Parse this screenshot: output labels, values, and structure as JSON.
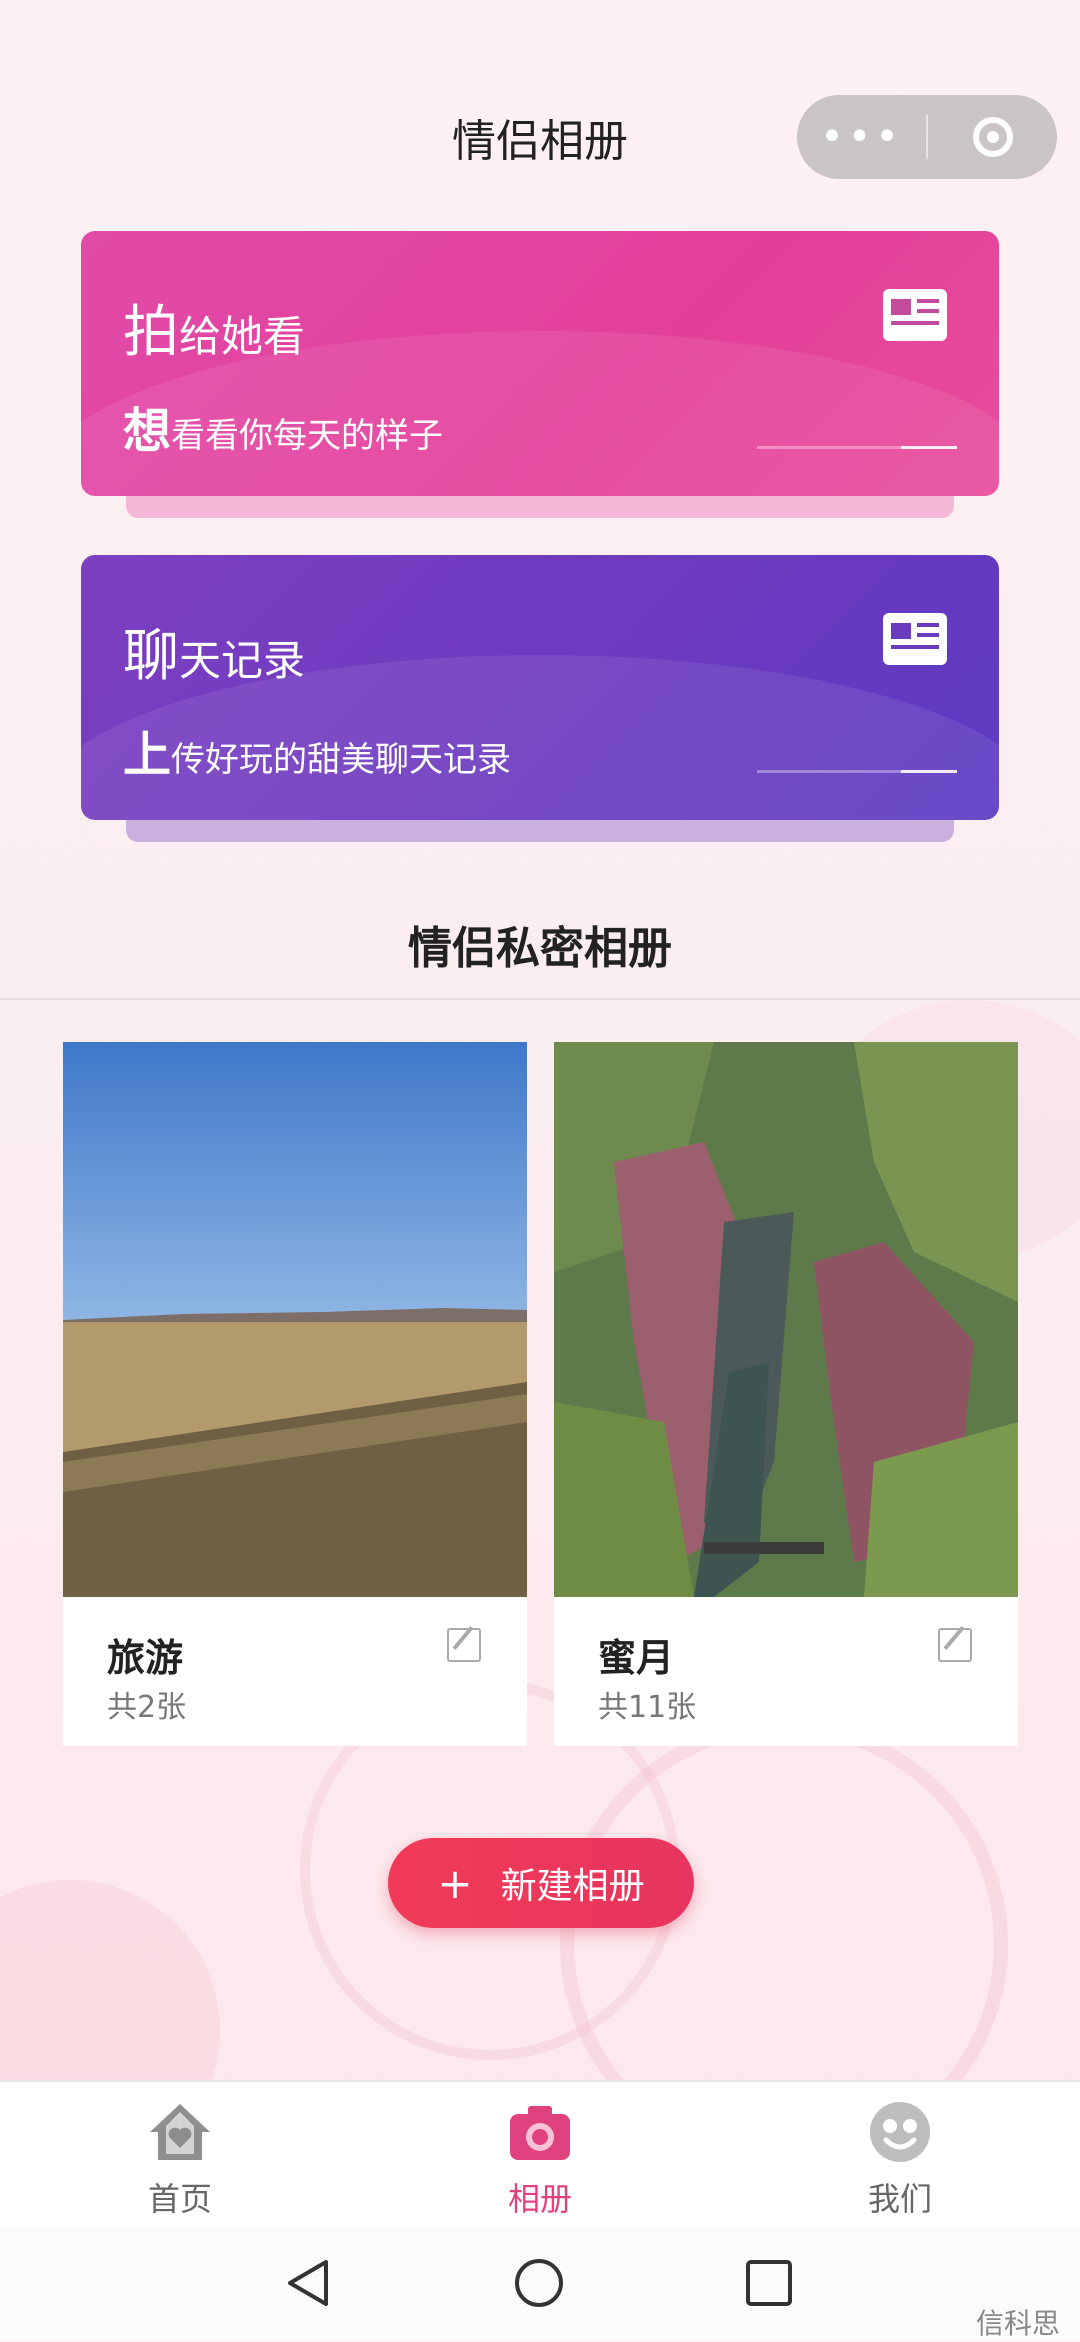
{
  "header": {
    "title": "情侣相册"
  },
  "cards": [
    {
      "title_big": "拍",
      "title_rest": "给她看",
      "sub_big": "想",
      "sub_rest": "看看你每天的样子",
      "color": "#e24aa8",
      "icon": "card-news-icon"
    },
    {
      "title_big": "聊",
      "title_rest": "天记录",
      "sub_big": "上",
      "sub_rest": "传好玩的甜美聊天记录",
      "color": "#6a3abf",
      "icon": "card-news-icon"
    }
  ],
  "section": {
    "title": "情侣私密相册"
  },
  "albums": [
    {
      "name": "旅游",
      "count": "共2张",
      "photo": "grassland-photo"
    },
    {
      "name": "蜜月",
      "count": "共11张",
      "photo": "canyon-photo"
    }
  ],
  "new_album": {
    "label": "新建相册",
    "icon": "plus-icon"
  },
  "tabs": [
    {
      "label": "首页",
      "icon": "home-icon",
      "active": false
    },
    {
      "label": "相册",
      "icon": "camera-icon",
      "active": true
    },
    {
      "label": "我们",
      "icon": "smiley-icon",
      "active": false
    }
  ],
  "system_nav": {
    "back": "back-triangle-icon",
    "home": "home-circle-icon",
    "recents": "recents-square-icon"
  },
  "watermark": "信科思",
  "colors": {
    "accent": "#e0427f",
    "button": "#f03a57",
    "card_pink": "#e24aa8",
    "card_purple": "#6a3abf"
  }
}
